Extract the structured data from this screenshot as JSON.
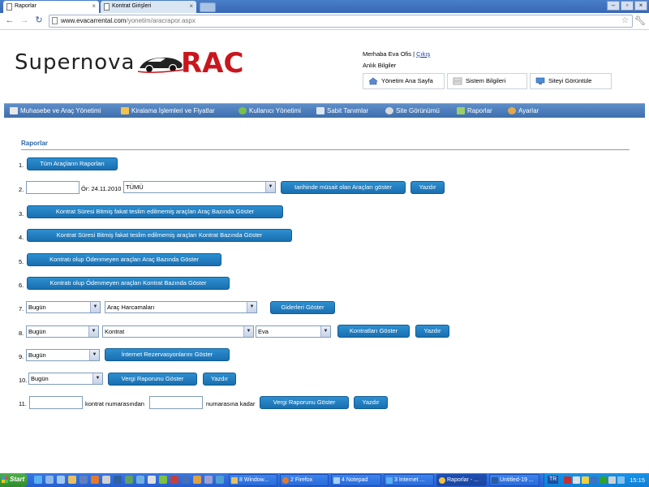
{
  "browser": {
    "tabs": [
      {
        "label": "Raporlar",
        "active": true
      },
      {
        "label": "Kontrat Girişleri",
        "active": false
      }
    ],
    "url_host": "www.evacarrental.com",
    "url_path": "/yonetim/aracrapor.aspx"
  },
  "header": {
    "logo_text": "Supernova",
    "logo_accent": "RAC",
    "greeting": "Merhaba Eva Ofis",
    "separator": "|",
    "logout": "Çıkış",
    "anlik": "Anlık Bilgiler",
    "quick_links": [
      "Yönetim Ana Sayfa",
      "Sistem Bilgileri",
      "Siteyi Görüntüle"
    ]
  },
  "menu": [
    "Muhasebe ve Araç Yönetimi",
    "Kiralama İşlemleri ve Fiyatlar",
    "Kullanıcı Yönetimi",
    "Sabit Tanımlar",
    "Site Görünümü",
    "Raporlar",
    "Ayarlar"
  ],
  "section_title": "Raporlar",
  "rows": {
    "r1": {
      "num": "1.",
      "button": "Tüm Araçların Raporları"
    },
    "r2": {
      "num": "2.",
      "date_value": "",
      "hint": "Ör: 24.11.2010",
      "select": "TÜMÜ",
      "button": "tarihinde müsait olan Araçları göster",
      "print": "Yazdır"
    },
    "r3": {
      "num": "3.",
      "button": "Kontrat Süresi Bitmiş fakat teslim edilmemiş araçları Araç Bazında Göster"
    },
    "r4": {
      "num": "4.",
      "button": "Kontrat Süresi Bitmiş fakat teslim edilmemiş araçları Kontrat Bazında Göster"
    },
    "r5": {
      "num": "5.",
      "button": "Kontratı olup Ödenmeyen araçları Araç Bazında Göster"
    },
    "r6": {
      "num": "6.",
      "button": "Kontratı olup Ödenmeyen araçları Kontrat Bazında Göster"
    },
    "r7": {
      "num": "7.",
      "select1": "Bugün",
      "select2": "Araç Harcamaları",
      "button": "Giderleri Göster"
    },
    "r8": {
      "num": "8.",
      "select1": "Bugün",
      "select2": "Kontrat",
      "select3": "Eva",
      "button": "Kontratları Göster",
      "print": "Yazdır"
    },
    "r9": {
      "num": "9.",
      "select1": "Bugün",
      "button": "İnternet Rezervasyonlarını Göster"
    },
    "r10": {
      "num": "10.",
      "select1": "Bugün",
      "button": "Vergi Raporunu Göster",
      "print": "Yazdır"
    },
    "r11": {
      "num": "11.",
      "from_value": "",
      "from_label": "kontrat numarasından",
      "to_value": "",
      "to_label": "numarasına kadar",
      "button": "Vergi Raporunu Göster",
      "print": "Yazdır"
    }
  },
  "taskbar": {
    "start": "Start",
    "buttons": [
      "8 Window...",
      "2 Firefox",
      "4 Notepad",
      "3 Internet ...",
      "Raporlar - ...",
      "Untitled-19 ..."
    ],
    "lang": "TR",
    "clock": "15:15"
  },
  "colors": {
    "menu_bar": "#4a7dbc",
    "button": "#1f7bc0",
    "section_title": "#2b66a6",
    "logo_accent": "#c9161d",
    "taskbar": "#245ed1"
  }
}
